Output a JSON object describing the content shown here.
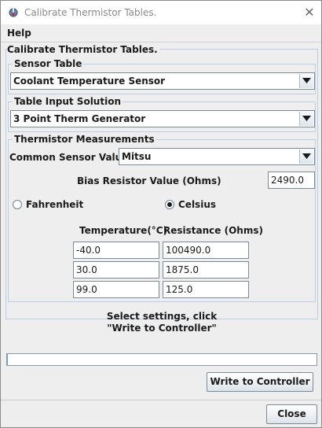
{
  "window": {
    "title": "Calibrate Thermistor Tables.",
    "close_glyph": "✕"
  },
  "menu": {
    "help": "Help"
  },
  "main_title": "Calibrate Thermistor Tables.",
  "sensor_table": {
    "legend": "Sensor Table",
    "selected": "Coolant Temperature Sensor"
  },
  "table_input": {
    "legend": "Table Input Solution",
    "selected": "3 Point Therm Generator"
  },
  "measurements": {
    "legend": "Thermistor Measurements",
    "common_label": "Common Sensor Values",
    "common_selected": "Mitsu",
    "bias_label": "Bias Resistor Value (Ohms)",
    "bias_value": "2490.0",
    "fahrenheit_label": "Fahrenheit",
    "celsius_label": "Celsius",
    "unit_selected": "Celsius",
    "temp_header": "Temperature(°C)",
    "resistance_header": "Resistance (Ohms)",
    "rows": [
      {
        "temp": "-40.0",
        "resistance": "100490.0"
      },
      {
        "temp": "30.0",
        "resistance": "1875.0"
      },
      {
        "temp": "99.0",
        "resistance": "125.0"
      }
    ]
  },
  "status": {
    "line1": "Select settings, click",
    "line2": "\"Write to Controller\""
  },
  "progress": {
    "value": 0
  },
  "buttons": {
    "write": "Write to Controller",
    "close": "Close"
  },
  "icons": {
    "app": "thermistor-app-icon",
    "dropdown": "chevron-down-icon"
  },
  "colors": {
    "border_accent": "#b8cfe5",
    "progress_fill": "#6a9fd4"
  }
}
